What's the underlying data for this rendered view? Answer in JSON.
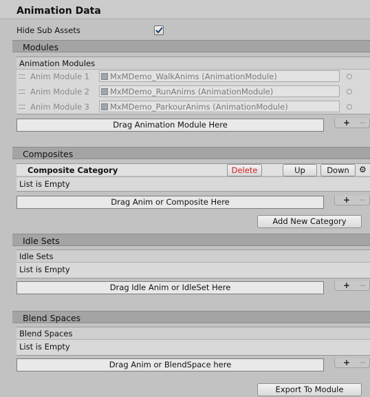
{
  "header": {
    "title": "Animation Data"
  },
  "settings": {
    "hide_sub_assets_label": "Hide Sub Assets",
    "hide_sub_assets_checked": true
  },
  "modules": {
    "section_title": "Modules",
    "list_title": "Animation Modules",
    "items": [
      {
        "label": "Anim Module 1",
        "value": "MxMDemo_WalkAnims (AnimationModule)"
      },
      {
        "label": "Anim Module 2",
        "value": "MxMDemo_RunAnims (AnimationModule)"
      },
      {
        "label": "Anim Module 3",
        "value": "MxMDemo_ParkourAnims (AnimationModule)"
      }
    ],
    "drop_label": "Drag Animation Module Here"
  },
  "composites": {
    "section_title": "Composites",
    "category_title": "Composite Category",
    "delete_label": "Delete",
    "up_label": "Up",
    "down_label": "Down",
    "empty_label": "List is Empty",
    "drop_label": "Drag Anim or Composite Here",
    "add_category_label": "Add New Category"
  },
  "idle_sets": {
    "section_title": "Idle Sets",
    "list_title": "Idle Sets",
    "empty_label": "List is Empty",
    "drop_label": "Drag Idle Anim or IdleSet Here"
  },
  "blend_spaces": {
    "section_title": "Blend Spaces",
    "list_title": "Blend Spaces",
    "empty_label": "List is Empty",
    "drop_label": "Drag Anim or BlendSpace here"
  },
  "footer": {
    "add_symbol": "+",
    "remove_symbol": "−"
  },
  "export_label": "Export To Module",
  "colors": {
    "delete_text": "#d22222",
    "panel_bg": "#c2c2c2",
    "section_header_bg": "#a4a4a4"
  }
}
